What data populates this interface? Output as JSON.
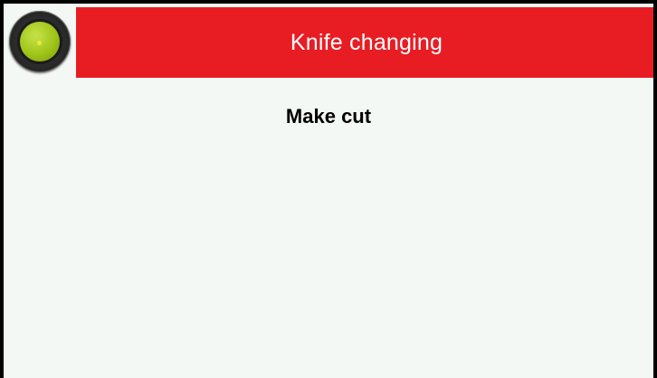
{
  "header": {
    "title": "Knife changing",
    "background_color": "#e81d24"
  },
  "knob": {
    "icon": "rotary-knob-icon",
    "face_color": "#9fc418"
  },
  "main": {
    "message": "Make cut"
  }
}
